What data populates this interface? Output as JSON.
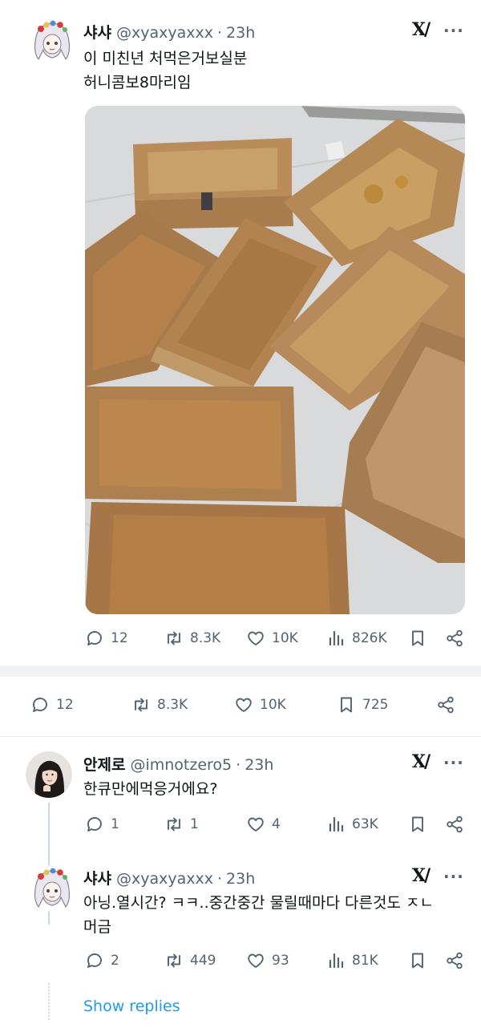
{
  "colors": {
    "text": "#0f1419",
    "secondary": "#536471",
    "link": "#1d9bf0",
    "divider": "#e7e9ea"
  },
  "main_tweet": {
    "name": "샤샤",
    "handle": "@xyaxyaxxx",
    "separator": "·",
    "time": "23h",
    "grok_label": "X/",
    "more_label": "···",
    "text": "이 미친년 처먹은거보실분\n허니콤보8마리임",
    "image_description": "eight empty greasy cardboard chicken boxes on a floor",
    "stats": {
      "replies": "12",
      "reposts": "8.3K",
      "likes": "10K",
      "views": "826K"
    },
    "stats_bar": {
      "replies": "12",
      "reposts": "8.3K",
      "likes": "10K",
      "bookmarks": "725"
    },
    "icons": [
      "reply-icon",
      "repost-icon",
      "like-icon",
      "views-icon",
      "bookmark-icon",
      "share-icon"
    ]
  },
  "reply1": {
    "name": "안제로",
    "handle": "@imnotzero5",
    "separator": "·",
    "time": "23h",
    "grok_label": "X/",
    "more_label": "···",
    "text": "한큐만에먹응거에요?",
    "stats": {
      "replies": "1",
      "reposts": "1",
      "likes": "4",
      "views": "63K"
    }
  },
  "reply2": {
    "name": "샤샤",
    "handle": "@xyaxyaxxx",
    "separator": "·",
    "time": "23h",
    "grok_label": "X/",
    "more_label": "···",
    "text": "아닝.열시간? ㅋㅋ..중간중간 물릴때마다 다른것도 ㅈㄴ\n머금",
    "stats": {
      "replies": "2",
      "reposts": "449",
      "likes": "93",
      "views": "81K"
    }
  },
  "show_replies_label": "Show replies"
}
